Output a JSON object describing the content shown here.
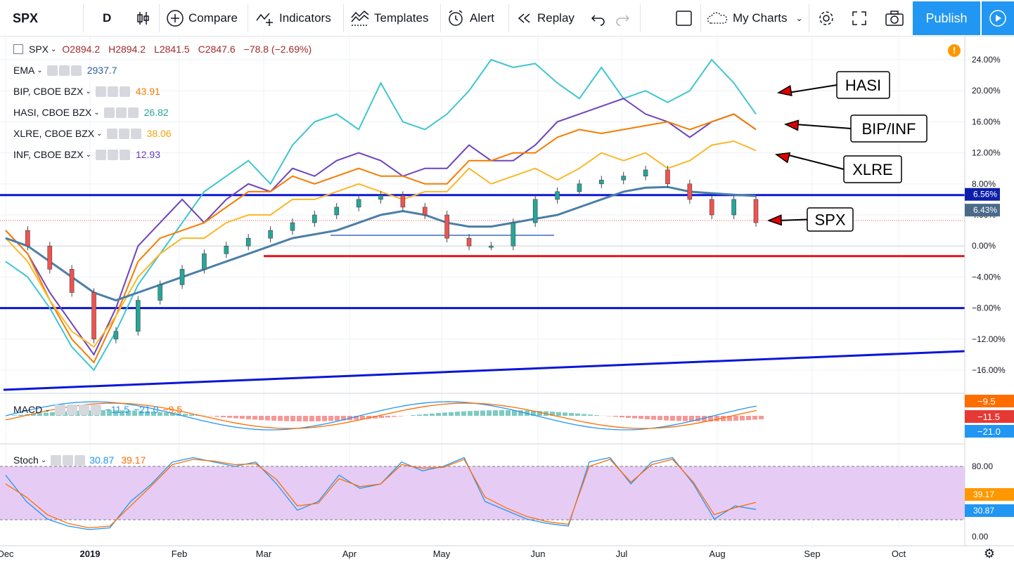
{
  "toolbar": {
    "symbol": "SPX",
    "interval": "D",
    "compare": "Compare",
    "indicators": "Indicators",
    "templates": "Templates",
    "alert": "Alert",
    "replay": "Replay",
    "my_charts": "My Charts",
    "publish": "Publish"
  },
  "legend": {
    "symbol": "SPX",
    "open": "O2894.2",
    "high": "H2894.2",
    "low": "L2841.5",
    "close": "C2847.6",
    "change": "−78.8 (−2.69%)",
    "rows": [
      {
        "name": "EMA",
        "value": "2937.7",
        "color": "#2b5f9e"
      },
      {
        "name": "BIP, CBOE BZX",
        "value": "43.91",
        "color": "#f57c00"
      },
      {
        "name": "HASI, CBOE BZX",
        "value": "26.82",
        "color": "#26a69a"
      },
      {
        "name": "XLRE, CBOE BZX",
        "value": "38.06",
        "color": "#f0a30a"
      },
      {
        "name": "INF, CBOE BZX",
        "value": "12.93",
        "color": "#673ab7"
      }
    ]
  },
  "annotations": [
    "HASI",
    "BIP/INF",
    "XLRE",
    "SPX"
  ],
  "macd_legend": {
    "name": "MACD",
    "v1": "−11.5",
    "v2": "−21.0",
    "v3": "−9.5"
  },
  "stoch_legend": {
    "name": "Stoch",
    "k": "30.87",
    "d": "39.17"
  },
  "chart_data": [
    {
      "type": "line",
      "title": "SPX",
      "x_labels": [
        "Dec",
        "2019",
        "Feb",
        "Mar",
        "Apr",
        "May",
        "Jun",
        "Jul",
        "Aug",
        "Sep",
        "Oct"
      ],
      "y_ticks": [
        "24.00%",
        "20.00%",
        "16.00%",
        "12.00%",
        "8.00%",
        "4.00%",
        "0.00%",
        "−4.00%",
        "−8.00%",
        "−12.00%",
        "−16.00%"
      ],
      "price_tags": [
        {
          "label": "6.56%",
          "value": 6.56,
          "color": "#0d1ea8"
        },
        {
          "label": "6.43%",
          "value": 6.43,
          "color": "#4a6a8a"
        }
      ],
      "horizontal_lines": [
        {
          "value": 6.56,
          "color": "#0b16d6"
        },
        {
          "value": -1.3,
          "color": "#e8161d"
        },
        {
          "value": -8.0,
          "color": "#0b16d6"
        }
      ],
      "ylim": [
        -18.5,
        25
      ],
      "series": [
        {
          "name": "HASI",
          "color": "#3fc6cf",
          "values": [
            -2,
            -4,
            -8,
            -13,
            -16,
            -11,
            -5,
            -1,
            3,
            7,
            9,
            11,
            8,
            13,
            16,
            17,
            15,
            21,
            16,
            15,
            17,
            20,
            24,
            23,
            23.5,
            21,
            19,
            23,
            19,
            20,
            18.5,
            20,
            24,
            21,
            17
          ]
        },
        {
          "name": "INF",
          "color": "#6d45b8",
          "values": [
            2,
            -1,
            -6,
            -10,
            -14,
            -8,
            0,
            3,
            6,
            3,
            6,
            8,
            7,
            10,
            9,
            11,
            12,
            11,
            9,
            10,
            10,
            13,
            11,
            11,
            13,
            16,
            17,
            18,
            19,
            17,
            16,
            14,
            16,
            17,
            15
          ]
        },
        {
          "name": "BIP",
          "color": "#f57c00",
          "values": [
            2,
            -1,
            -7,
            -12,
            -15,
            -9,
            -2,
            1,
            2,
            3,
            5,
            7,
            7,
            9,
            8,
            9,
            10,
            9,
            9,
            8,
            8,
            11,
            11,
            12,
            12,
            14,
            15,
            14.5,
            15,
            15.5,
            16,
            15,
            16,
            17,
            15
          ]
        },
        {
          "name": "XLRE",
          "color": "#f9b829",
          "values": [
            1,
            -2,
            -7,
            -11,
            -13,
            -9,
            -4,
            -1,
            1,
            1,
            3,
            4,
            4,
            6,
            6,
            7,
            8,
            7,
            6,
            7,
            7,
            10,
            8,
            9,
            10,
            8.5,
            10,
            12,
            11,
            12,
            10,
            11,
            13,
            13.5,
            12.3
          ]
        },
        {
          "name": "SPX",
          "color": "#1f7a6d",
          "values": [
            2,
            0,
            -3,
            -6,
            -12,
            -11,
            -7,
            -5,
            -3,
            -1,
            0,
            1,
            2,
            3,
            4,
            5,
            6,
            6.5,
            5,
            4,
            1,
            0,
            0,
            3,
            6,
            7,
            8,
            8.5,
            9,
            9.8,
            8,
            6,
            4,
            6,
            3
          ]
        },
        {
          "name": "EMA",
          "color": "#4a7fa7",
          "values": [
            1,
            0,
            -2,
            -4,
            -6,
            -7,
            -6,
            -5,
            -4,
            -3,
            -2,
            -1,
            0,
            1,
            1.5,
            2,
            3,
            4,
            4.5,
            4,
            3,
            2.5,
            2.5,
            3,
            3.5,
            4,
            5,
            6,
            7,
            7.5,
            7.6,
            7,
            6.8,
            6.6,
            6.43
          ]
        }
      ]
    },
    {
      "type": "bar",
      "title": "MACD",
      "y_ticks": [
        {
          "label": "−9.5",
          "color": "#ff6d00"
        },
        {
          "label": "−11.5",
          "color": "#e53935"
        },
        {
          "label": "−21.0",
          "color": "#2196f3"
        }
      ]
    },
    {
      "type": "line",
      "title": "Stoch",
      "y_ticks": [
        "80.00",
        "39.17",
        "30.87",
        "0.00"
      ],
      "series": [
        {
          "name": "K",
          "color": "#2196f3",
          "values": [
            70,
            40,
            20,
            12,
            8,
            10,
            40,
            60,
            85,
            90,
            85,
            80,
            85,
            60,
            30,
            40,
            70,
            55,
            60,
            85,
            75,
            80,
            90,
            40,
            30,
            20,
            15,
            12,
            85,
            90,
            60,
            85,
            90,
            60,
            20,
            35,
            31
          ]
        },
        {
          "name": "D",
          "color": "#ff6d00",
          "values": [
            60,
            45,
            25,
            15,
            10,
            12,
            35,
            58,
            82,
            88,
            86,
            82,
            83,
            65,
            35,
            38,
            66,
            57,
            60,
            82,
            78,
            79,
            88,
            45,
            33,
            23,
            17,
            14,
            80,
            88,
            62,
            82,
            88,
            62,
            25,
            33,
            39
          ]
        }
      ]
    }
  ]
}
